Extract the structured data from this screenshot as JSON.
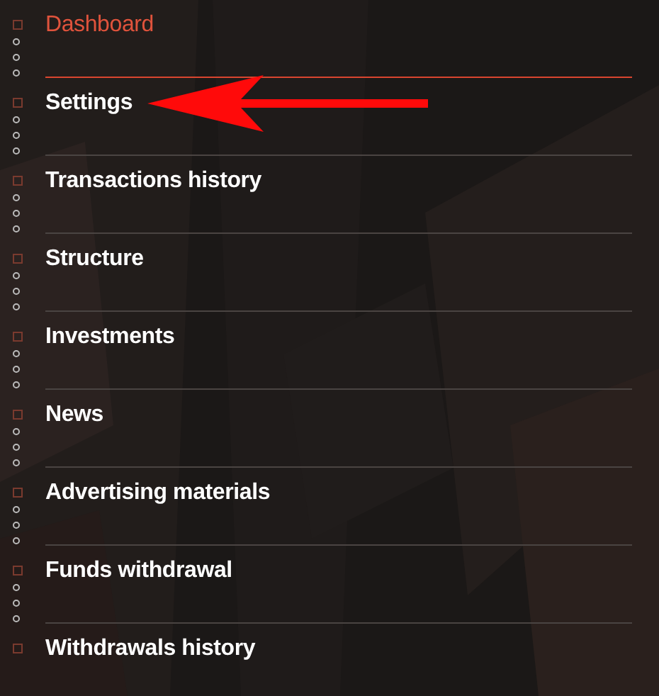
{
  "menu": {
    "items": [
      {
        "label": "Dashboard",
        "selected": true
      },
      {
        "label": "Settings",
        "selected": false
      },
      {
        "label": "Transactions history",
        "selected": false
      },
      {
        "label": "Structure",
        "selected": false
      },
      {
        "label": "Investments",
        "selected": false
      },
      {
        "label": "News",
        "selected": false
      },
      {
        "label": "Advertising materials",
        "selected": false
      },
      {
        "label": "Funds withdrawal",
        "selected": false
      },
      {
        "label": "Withdrawals history",
        "selected": false
      }
    ]
  }
}
